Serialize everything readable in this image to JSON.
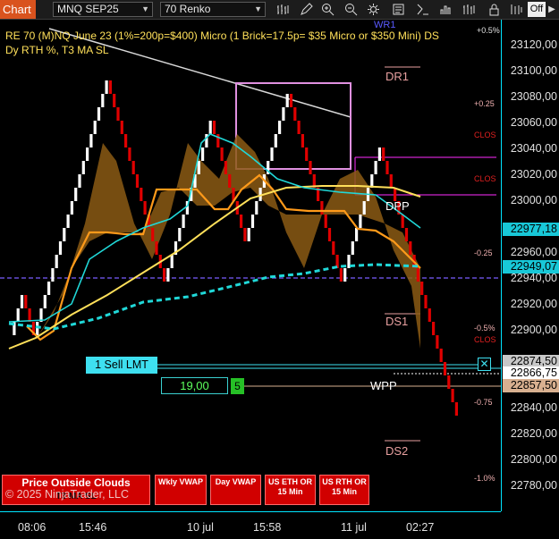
{
  "toolbar": {
    "tab": "Chart",
    "instrument": "MNQ SEP25",
    "bar_type": "70 Renko",
    "off_toggle": "Off",
    "icons": [
      "bars-icon",
      "pencil-icon",
      "zoom-in-icon",
      "zoom-out-icon",
      "gear-icon",
      "data-box-icon",
      "strategy-icon",
      "order-entry-icon",
      "layers-icon",
      "lock-icon"
    ]
  },
  "header": {
    "line1": "RE 70 (M)NQ June 23 (1%=200p=$400) Micro (1 Brick=17.5p= $35 Micro or $350 Mini) DS",
    "line2": "Dy RTH %, T3 MA SL"
  },
  "price_axis": {
    "ticks": [
      "23120,00",
      "23100,00",
      "23080,00",
      "23060,00",
      "23040,00",
      "23020,00",
      "23000,00",
      "22960,00",
      "22940,00",
      "22920,00",
      "22900,00",
      "22840,00",
      "22820,00",
      "22800,00",
      "22780,00"
    ],
    "tags": [
      {
        "label": "22977,18",
        "color": "#18c8d8"
      },
      {
        "label": "22949,07",
        "color": "#18c8d8"
      },
      {
        "label": "22874,50",
        "color": "#c8c8c8"
      },
      {
        "label": "22866,75",
        "color": "#ffffff"
      },
      {
        "label": "22857,50",
        "color": "#d8b090"
      }
    ]
  },
  "time_axis": {
    "ticks": [
      "08:06",
      "15:46",
      "10 jul",
      "15:58",
      "11 jul",
      "02:27"
    ]
  },
  "chart_labels": {
    "dr1": "DR1",
    "dpp": "DPP",
    "ds1": "DS1",
    "wpp": "WPP",
    "ds2": "DS2",
    "pct_top": "+0.5%",
    "pct_025": "+0.25",
    "close1": "CLOS",
    "close2": "CLOS",
    "pct_m025": "-0.25",
    "pct_m05": "-0.5%",
    "close3": "CLOS",
    "pct_m075": "-0.75",
    "pct_m1": "-1.0%",
    "wr1": "WR1",
    "top_faint": "R 0%"
  },
  "order": {
    "label": "1  Sell LMT",
    "qty": "19,00",
    "qty_badge": "5"
  },
  "buttons": {
    "price_outside": "Price Outside Clouds",
    "price_outside_sub": "T3 MA SL",
    "copyright": "© 2025 NinjaTrader, LLC",
    "wkly_vwap": "Wkly VWAP",
    "day_vwap": "Day VWAP",
    "us_eth": "US ETH OR",
    "us_eth_sub": "15 Min",
    "us_rth": "US RTH OR",
    "us_rth_sub": "15 Min"
  },
  "colors": {
    "accent_tab": "#d9531e",
    "up_brick": "#ffffff",
    "down_brick": "#e00000",
    "cloud": "#8b5a14",
    "band": "#ff9a1a",
    "ma_yellow": "#ffe05a",
    "ma_cyan": "#20d8d8",
    "axis_border": "#00e5ff",
    "dashed_mid": "#7a5cff"
  }
}
